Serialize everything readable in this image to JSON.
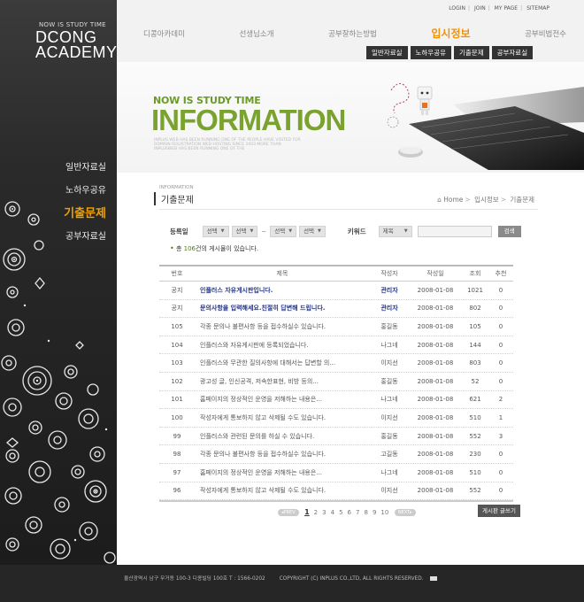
{
  "logo": {
    "small": "NOW IS STUDY TIME",
    "line1": "DCONG",
    "line2": "ACADEMY"
  },
  "sidebar": {
    "items": [
      {
        "label": "일반자료실",
        "active": false
      },
      {
        "label": "노하우공유",
        "active": false
      },
      {
        "label": "기출문제",
        "active": true
      },
      {
        "label": "공부자료실",
        "active": false
      }
    ]
  },
  "utility": {
    "login": "LOGIN",
    "join": "JOIN",
    "mypage": "MY PAGE",
    "sitemap": "SITEMAP"
  },
  "nav": {
    "items": [
      {
        "label": "디콩아카데미"
      },
      {
        "label": "선생님소개"
      },
      {
        "label": "공부잘하는방법"
      },
      {
        "label": "입시정보",
        "active": true
      },
      {
        "label": "공부비법전수"
      }
    ],
    "subtabs": [
      "일반자료실",
      "노하우공유",
      "기출문제",
      "공부자료실"
    ]
  },
  "banner": {
    "subtitle": "NOW IS STUDY TIME",
    "title": "INFORMATION",
    "desc": "INPLUS WEB HAS BEEN RUNNING ONE OF THE PEOPLE HAVE VISITED FOR DOMAIN REGISTRATION WEB HOSTING SINCE 2003 MORE THAN INPLUSWEB HAS BEEN RUNNING ONE OF THE"
  },
  "page": {
    "subtitle": "INFORMATION",
    "title": "기출문제",
    "breadcrumb": [
      "Home",
      "입시정보",
      "기출문제"
    ]
  },
  "search": {
    "date_label": "등록일",
    "select_placeholder": "선택",
    "keyword_label": "키워드",
    "keyword_select": "제목",
    "button": "검색"
  },
  "count": {
    "prefix": "총 ",
    "num": "106",
    "suffix": "건의 게시물이 있습니다."
  },
  "table": {
    "headers": {
      "no": "번호",
      "title": "제목",
      "writer": "작성자",
      "date": "작성일",
      "views": "조회",
      "rec": "추천"
    },
    "rows": [
      {
        "no": "공지",
        "title": "인플러스 자유게시판입니다.",
        "writer": "관리자",
        "date": "2008-01-08",
        "views": "1021",
        "rec": "0",
        "notice": true
      },
      {
        "no": "공지",
        "title": "문의사항을 입력해세요.친절히 답변해 드립니다.",
        "writer": "관리자",
        "date": "2008-01-08",
        "views": "802",
        "rec": "0",
        "notice": true
      },
      {
        "no": "105",
        "title": "각종 문의나 불편사항 등을 접수하실수 있습니다.",
        "writer": "홍길동",
        "date": "2008-01-08",
        "views": "105",
        "rec": "0"
      },
      {
        "no": "104",
        "title": "인플러스와 자유게시판에 등록되었습니다.",
        "writer": "나그네",
        "date": "2008-01-08",
        "views": "144",
        "rec": "0"
      },
      {
        "no": "103",
        "title": "인플러스와 무관한 질의사항에 대해서는 답변할 의...",
        "writer": "이지선",
        "date": "2008-01-08",
        "views": "803",
        "rec": "0"
      },
      {
        "no": "102",
        "title": "광고성 글, 인신공격, 저속한표현, 비방 등의...",
        "writer": "홍길동",
        "date": "2008-01-08",
        "views": "52",
        "rec": "0"
      },
      {
        "no": "101",
        "title": "홈페이지의 정상적인 운영을 저해하는 내용은...",
        "writer": "나그네",
        "date": "2008-01-08",
        "views": "621",
        "rec": "2"
      },
      {
        "no": "100",
        "title": "작성자에게 통보하지 않고 삭제될 수도 있습니다.",
        "writer": "이지선",
        "date": "2008-01-08",
        "views": "510",
        "rec": "1"
      },
      {
        "no": "99",
        "title": "인플러스와 관련된 문의를 하실 수 있습니다.",
        "writer": "홍길동",
        "date": "2008-01-08",
        "views": "552",
        "rec": "3"
      },
      {
        "no": "98",
        "title": "각종 문의나 불편사항 등을 접수하실수 있습니다.",
        "writer": "고길동",
        "date": "2008-01-08",
        "views": "230",
        "rec": "0"
      },
      {
        "no": "97",
        "title": "홈페이지의 정상적인 운영을 저해하는 내용은...",
        "writer": "나그네",
        "date": "2008-01-08",
        "views": "510",
        "rec": "0"
      },
      {
        "no": "96",
        "title": "작성자에게 통보하지 않고 삭제될 수도 있습니다.",
        "writer": "이지선",
        "date": "2008-01-08",
        "views": "552",
        "rec": "0"
      }
    ]
  },
  "pager": {
    "prev": "PREV",
    "next": "NEXT",
    "pages": [
      "1",
      "2",
      "3",
      "4",
      "5",
      "6",
      "7",
      "8",
      "9",
      "10"
    ],
    "current": "1"
  },
  "write_button": "게시판 글쓰기",
  "footer": {
    "address": "울산광역시 남구 무거동 100-3 디콩빌딩 100호   T : 1566-0202",
    "copyright": "COPYRIGHT (C) INPLUS CO.,LTD, ALL RIGHTS RESERVED."
  },
  "colors": {
    "accent": "#f0920a",
    "brand_green": "#7aa22e",
    "notice_blue": "#24358a"
  }
}
